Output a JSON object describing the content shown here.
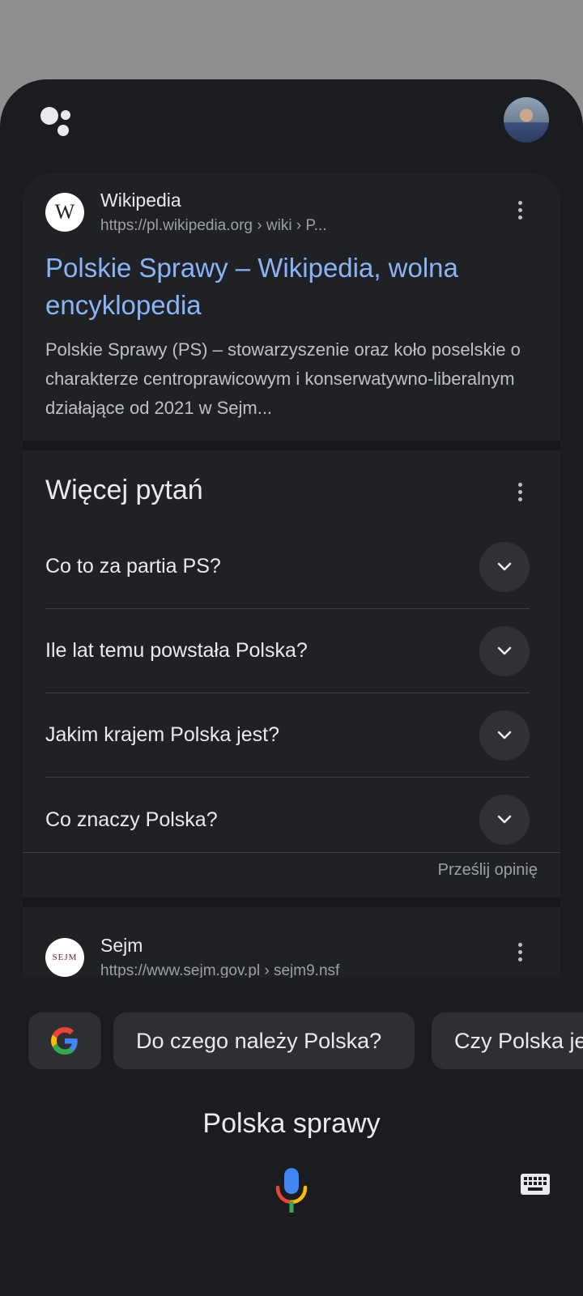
{
  "header": {
    "assistant_logo_icon": "google-assistant-icon",
    "avatar_icon": "user-avatar"
  },
  "results": [
    {
      "site_name": "Wikipedia",
      "site_icon_letter": "W",
      "url": "https://pl.wikipedia.org › wiki › P...",
      "title": "Polskie Sprawy – Wikipedia, wolna encyklopedia",
      "snippet": "Polskie Sprawy (PS) – stowarzyszenie oraz koło poselskie o charakterze centroprawicowym i konserwatywno-liberalnym działające od 2021 w Sejm..."
    }
  ],
  "paa": {
    "title": "Więcej pytań",
    "questions": [
      "Co to za partia PS?",
      "Ile lat temu powstała Polska?",
      "Jakim krajem Polska jest?",
      "Co znaczy Polska?"
    ],
    "feedback": "Prześlij opinię"
  },
  "sejm_result": {
    "site_name": "Sejm",
    "url": "https://www.sejm.gov.pl › sejm9.nsf",
    "icon_text": "SEJM"
  },
  "chips": {
    "google_icon": "google-g-icon",
    "items": [
      "Do czego należy Polska?",
      "Czy Polska je"
    ]
  },
  "query": "Polska sprawy",
  "colors": {
    "sheet_bg": "#1b1c1f",
    "card_bg": "#202124",
    "link": "#8ab4f8",
    "backdrop": "#8f8f8f"
  }
}
